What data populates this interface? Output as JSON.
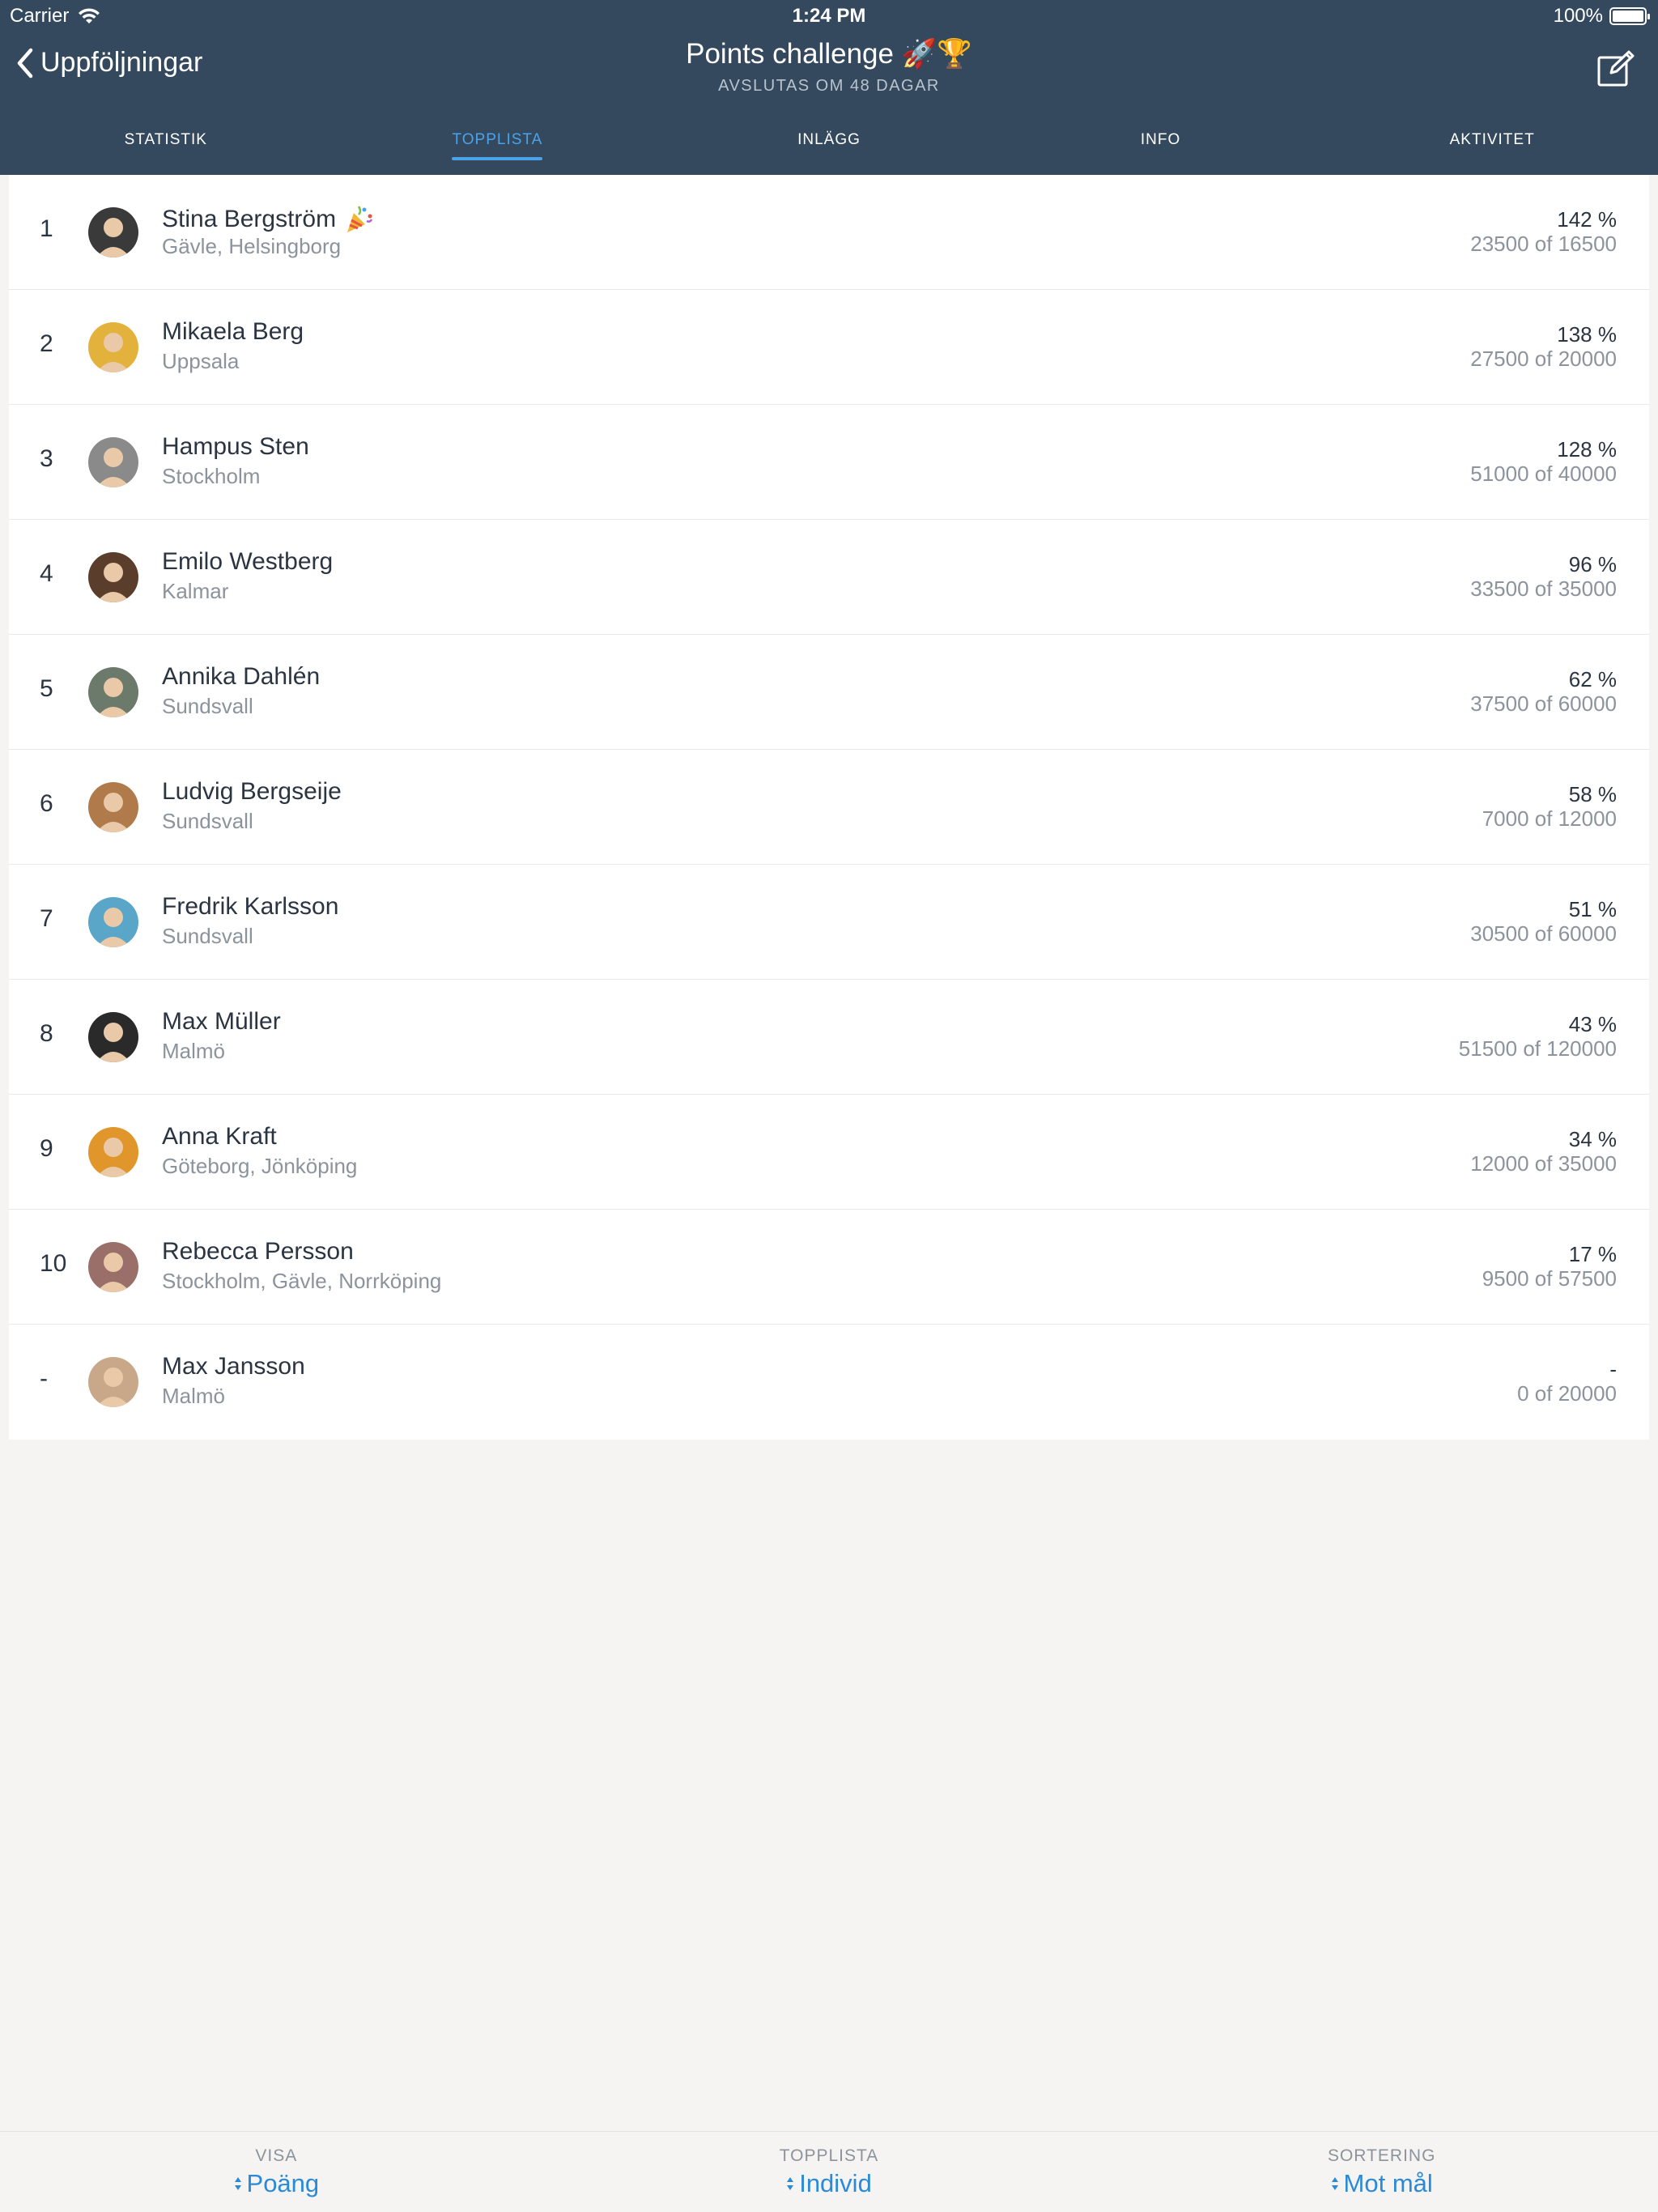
{
  "status_bar": {
    "carrier": "Carrier",
    "time": "1:24 PM",
    "battery": "100%"
  },
  "nav": {
    "back_label": "Uppföljningar",
    "title": "Points challenge 🚀🏆",
    "subtitle": "AVSLUTAS OM 48 DAGAR"
  },
  "tabs": [
    {
      "label": "STATISTIK",
      "active": false
    },
    {
      "label": "TOPPLISTA",
      "active": true
    },
    {
      "label": "INLÄGG",
      "active": false
    },
    {
      "label": "INFO",
      "active": false
    },
    {
      "label": "AKTIVITET",
      "active": false
    }
  ],
  "leaderboard": [
    {
      "rank": "1",
      "name": "Stina Bergström",
      "location": "Gävle, Helsingborg",
      "percent": "142 %",
      "progress": "23500 of 16500",
      "badge": "party-popper-icon",
      "avatar_color": "#3a3a3a"
    },
    {
      "rank": "2",
      "name": "Mikaela Berg",
      "location": "Uppsala",
      "percent": "138 %",
      "progress": "27500 of 20000",
      "avatar_color": "#e3b23c"
    },
    {
      "rank": "3",
      "name": "Hampus Sten",
      "location": "Stockholm",
      "percent": "128 %",
      "progress": "51000 of 40000",
      "avatar_color": "#8a8a8a"
    },
    {
      "rank": "4",
      "name": "Emilo Westberg",
      "location": "Kalmar",
      "percent": "96 %",
      "progress": "33500 of 35000",
      "avatar_color": "#5a3e2b"
    },
    {
      "rank": "5",
      "name": "Annika Dahlén",
      "location": "Sundsvall",
      "percent": "62 %",
      "progress": "37500 of 60000",
      "avatar_color": "#6b7a6a"
    },
    {
      "rank": "6",
      "name": "Ludvig Bergseije",
      "location": "Sundsvall",
      "percent": "58 %",
      "progress": "7000 of 12000",
      "avatar_color": "#b07a4a"
    },
    {
      "rank": "7",
      "name": "Fredrik Karlsson",
      "location": "Sundsvall",
      "percent": "51 %",
      "progress": "30500 of 60000",
      "avatar_color": "#5aa6c8"
    },
    {
      "rank": "8",
      "name": "Max Müller",
      "location": "Malmö",
      "percent": "43 %",
      "progress": "51500 of 120000",
      "avatar_color": "#2a2a2a"
    },
    {
      "rank": "9",
      "name": "Anna Kraft",
      "location": "Göteborg, Jönköping",
      "percent": "34 %",
      "progress": "12000 of 35000",
      "avatar_color": "#e0962a"
    },
    {
      "rank": "10",
      "name": "Rebecca Persson",
      "location": "Stockholm, Gävle, Norrköping",
      "percent": "17 %",
      "progress": "9500 of 57500",
      "avatar_color": "#9a6f6a"
    },
    {
      "rank": "-",
      "name": "Max Jansson",
      "location": "Malmö",
      "percent": "-",
      "progress": "0 of 20000",
      "avatar_color": "#c9a88a"
    }
  ],
  "bottom_bar": [
    {
      "label": "VISA",
      "value": "Poäng"
    },
    {
      "label": "TOPPLISTA",
      "value": "Individ"
    },
    {
      "label": "SORTERING",
      "value": "Mot mål"
    }
  ],
  "colors": {
    "header_bg": "#34495e",
    "accent": "#4aa3e8",
    "link": "#2a8ad8",
    "page_bg": "#f5f4f2"
  }
}
